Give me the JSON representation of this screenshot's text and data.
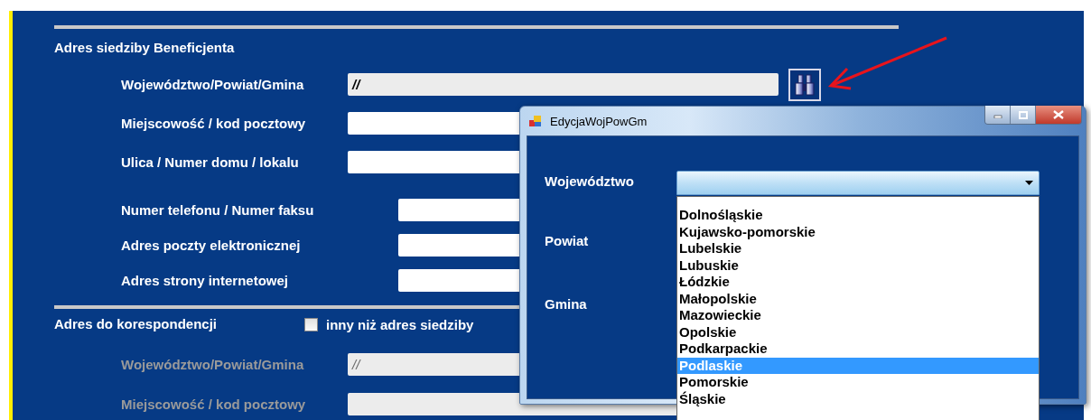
{
  "main_address": {
    "title": "Adres siedziby Beneficjenta",
    "fields": [
      {
        "label": "Województwo/Powiat/Gmina",
        "value": "//",
        "kind": "lookup"
      },
      {
        "label": "Miejscowość / kod pocztowy",
        "kind": "text"
      },
      {
        "label": "Ulica / Numer domu / lokalu",
        "kind": "text"
      }
    ]
  },
  "contact": {
    "fields": [
      {
        "label": "Numer telefonu / Numer faksu"
      },
      {
        "label": "Adres poczty elektronicznej"
      },
      {
        "label": "Adres strony internetowej"
      }
    ]
  },
  "correspondence": {
    "title": "Adres do korespondencji",
    "checkbox": {
      "label": "inny niż adres siedziby",
      "checked": false
    },
    "fields": [
      {
        "label": "Województwo/Powiat/Gmina",
        "value": "//",
        "disabled": true
      },
      {
        "label": "Miejscowość / kod pocztowy",
        "disabled": true
      }
    ]
  },
  "dialog": {
    "title": "EdycjaWojPowGm",
    "labels": [
      "Województwo",
      "Powiat",
      "Gmina"
    ],
    "dropdown": {
      "expanded": true,
      "items": [
        {
          "label": "Dolnośląskie",
          "selected": false
        },
        {
          "label": "Kujawsko-pomorskie",
          "selected": false
        },
        {
          "label": "Lubelskie",
          "selected": false
        },
        {
          "label": "Lubuskie",
          "selected": false
        },
        {
          "label": "Łódzkie",
          "selected": false
        },
        {
          "label": "Małopolskie",
          "selected": false
        },
        {
          "label": "Mazowieckie",
          "selected": false
        },
        {
          "label": "Opolskie",
          "selected": false
        },
        {
          "label": "Podkarpackie",
          "selected": false
        },
        {
          "label": "Podlaskie",
          "selected": true
        },
        {
          "label": "Pomorskie",
          "selected": false
        },
        {
          "label": "Śląskie",
          "selected": false
        }
      ]
    }
  }
}
